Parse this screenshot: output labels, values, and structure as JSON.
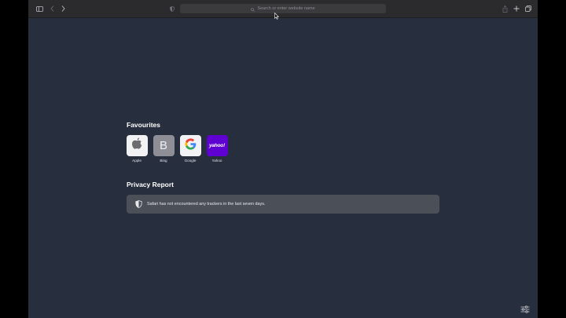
{
  "toolbar": {
    "search_placeholder": "Search or enter website name",
    "icons": [
      "sidebar-icon",
      "back-icon",
      "forward-icon",
      "privacy-shield-icon",
      "search-icon",
      "share-icon",
      "new-tab-icon",
      "tab-overview-icon"
    ]
  },
  "favourites": {
    "title": "Favourites",
    "items": [
      {
        "label": "Apple",
        "icon": "apple-icon",
        "color": "#f2f2f4"
      },
      {
        "label": "Bing",
        "letter": "B",
        "color": "#8e8e96"
      },
      {
        "label": "Google",
        "icon": "google-icon",
        "color": "#f2f2f4"
      },
      {
        "label": "Yahoo",
        "logo_text": "yahoo!",
        "color": "#5f01d1"
      }
    ]
  },
  "privacy": {
    "title": "Privacy Report",
    "message": "Safari has not encountered any trackers in the last seven days."
  },
  "colors": {
    "background": "#272f3f",
    "toolbar": "#2b2b2d",
    "card": "#4a4f58"
  }
}
